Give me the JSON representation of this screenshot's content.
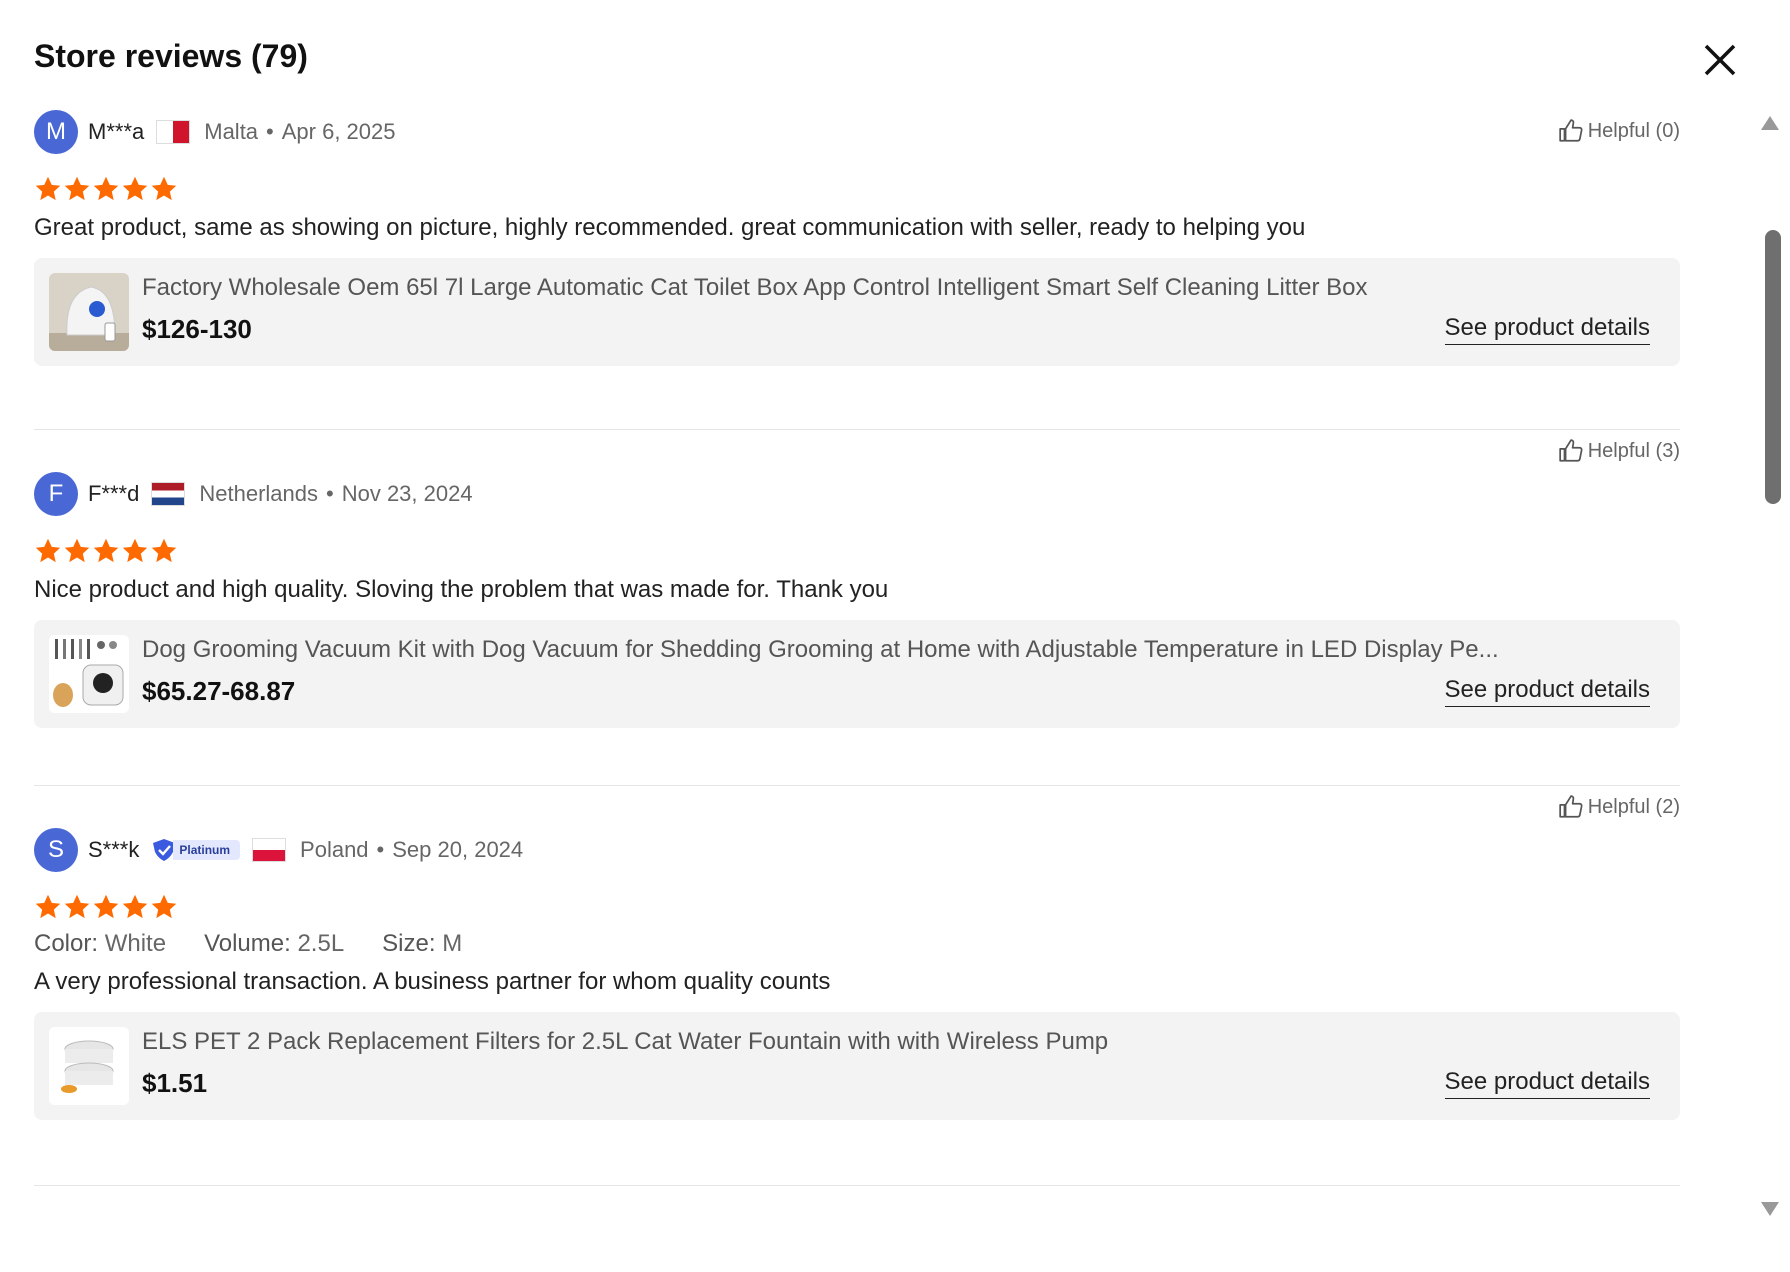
{
  "modal": {
    "title": "Store reviews (79)"
  },
  "reviews": [
    {
      "avatar_letter": "M",
      "name": "M***a",
      "badge": "",
      "country": "Malta",
      "date": "Apr 6, 2025",
      "helpful": "Helpful (0)",
      "rating": 5,
      "attributes": [],
      "text": "Great product, same as showing on picture, highly recommended. great communication with seller, ready to helping you",
      "product": {
        "title": "Factory Wholesale Oem 65l 7l Large Automatic Cat Toilet Box App Control Intelligent Smart Self Cleaning Litter Box",
        "price": "$126-130",
        "link": "See product details"
      }
    },
    {
      "avatar_letter": "F",
      "name": "F***d",
      "badge": "",
      "country": "Netherlands",
      "date": "Nov 23, 2024",
      "helpful": "Helpful (3)",
      "rating": 5,
      "attributes": [],
      "text": "Nice product and high quality. Sloving the problem that was made for. Thank you",
      "product": {
        "title": "Dog Grooming Vacuum Kit with Dog Vacuum for Shedding Grooming at Home with Adjustable Temperature in LED Display Pe...",
        "price": "$65.27-68.87",
        "link": "See product details"
      }
    },
    {
      "avatar_letter": "S",
      "name": "S***k",
      "badge": "Platinum",
      "country": "Poland",
      "date": "Sep 20, 2024",
      "helpful": "Helpful (2)",
      "rating": 5,
      "attributes": [
        {
          "name": "Color:",
          "value": "White"
        },
        {
          "name": "Volume:",
          "value": "2.5L"
        },
        {
          "name": "Size:",
          "value": "M"
        }
      ],
      "text": "A very professional transaction. A business partner for whom quality counts",
      "product": {
        "title": "ELS PET 2 Pack Replacement Filters for 2.5L Cat Water Fountain with with Wireless Pump",
        "price": "$1.51",
        "link": "See product details"
      }
    }
  ],
  "colors": {
    "star": "#ff6a00",
    "avatar": "#4a67d6",
    "card_bg": "#f3f3f3"
  },
  "icons": {
    "close": "close-icon",
    "helpful": "thumbs-up-icon",
    "star": "star-icon",
    "badge": "verified-shield-icon"
  }
}
